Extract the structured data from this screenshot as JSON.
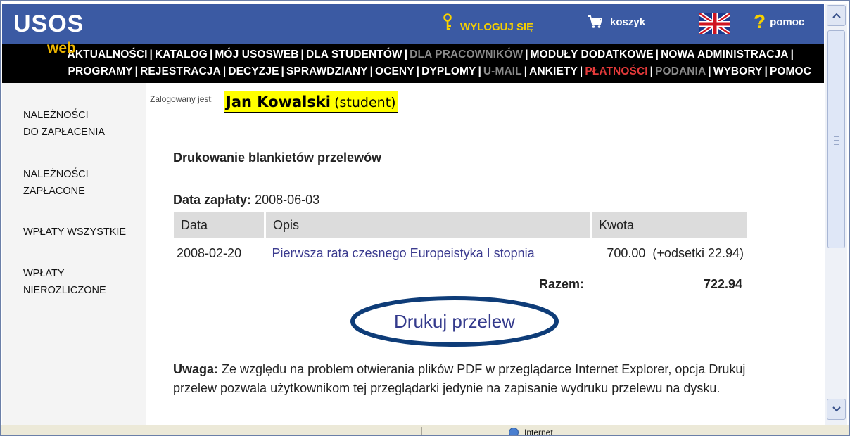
{
  "header": {
    "logo_main": "USOS",
    "logo_sub": "web",
    "logout_label": "WYLOGUJ SIĘ",
    "cart_label": "koszyk",
    "help_label": "pomoc"
  },
  "nav": {
    "row1": [
      {
        "label": "AKTUALNOŚCI",
        "state": "normal"
      },
      {
        "label": "KATALOG",
        "state": "normal"
      },
      {
        "label": "MÓJ USOSWEB",
        "state": "normal"
      },
      {
        "label": "DLA STUDENTÓW",
        "state": "normal"
      },
      {
        "label": "DLA PRACOWNIKÓW",
        "state": "disabled"
      },
      {
        "label": "MODUŁY DODATKOWE",
        "state": "normal"
      },
      {
        "label": "NOWA ADMINISTRACJA",
        "state": "normal"
      }
    ],
    "row2": [
      {
        "label": "PROGRAMY",
        "state": "normal"
      },
      {
        "label": "REJESTRACJA",
        "state": "normal"
      },
      {
        "label": "DECYZJE",
        "state": "normal"
      },
      {
        "label": "SPRAWDZIANY",
        "state": "normal"
      },
      {
        "label": "OCENY",
        "state": "normal"
      },
      {
        "label": "DYPLOMY",
        "state": "normal"
      },
      {
        "label": "U-MAIL",
        "state": "disabled"
      },
      {
        "label": "ANKIETY",
        "state": "normal"
      },
      {
        "label": "PŁATNOŚCI",
        "state": "active"
      },
      {
        "label": "PODANIA",
        "state": "disabled"
      },
      {
        "label": "WYBORY",
        "state": "normal"
      },
      {
        "label": "POMOC",
        "state": "normal"
      }
    ],
    "colors": {
      "normal": "#ffffff",
      "disabled": "#8a8a8a",
      "active": "#e43a3a"
    }
  },
  "sidebar": {
    "items": [
      {
        "line1": "NALEŻNOŚCI",
        "line2": "DO ZAPŁACENIA"
      },
      {
        "line1": "NALEŻNOŚCI",
        "line2": "ZAPŁACONE"
      },
      {
        "line1": "WPŁATY WSZYSTKIE",
        "line2": ""
      },
      {
        "line1": "WPŁATY",
        "line2": "NIEROZLICZONE"
      }
    ]
  },
  "user": {
    "logged_label": "Zalogowany jest:",
    "name": "Jan Kowalski",
    "role": "(student)"
  },
  "main": {
    "heading": "Drukowanie blankietów przelewów",
    "payment_date_label": "Data zapłaty:",
    "payment_date": "2008-06-03",
    "table": {
      "headers": [
        "Data",
        "Opis",
        "Kwota"
      ],
      "rows": [
        {
          "date": "2008-02-20",
          "desc": "Pierwsza rata czesnego Europeistyka I stopnia",
          "amount": "700.00",
          "interest": "(+odsetki 22.94)"
        }
      ]
    },
    "total_label": "Razem:",
    "total_value": "722.94",
    "print_button": "Drukuj przelew",
    "note_label": "Uwaga:",
    "note_text": "Ze względu na problem otwierania plików PDF w przeglądarce Internet Explorer, opcja Drukuj przelew pozwala użytkownikom tej przeglądarki jedynie na zapisanie wydruku przelewu na dysku."
  },
  "statusbar": {
    "text": "Internet"
  },
  "colors": {
    "header_blue": "#3b5aa3",
    "nav_black": "#000000",
    "accent_yellow": "#f6d000",
    "highlight_yellow": "#ffff00",
    "link_color": "#3b3b8f",
    "ellipse_stroke": "#0e3c78"
  }
}
